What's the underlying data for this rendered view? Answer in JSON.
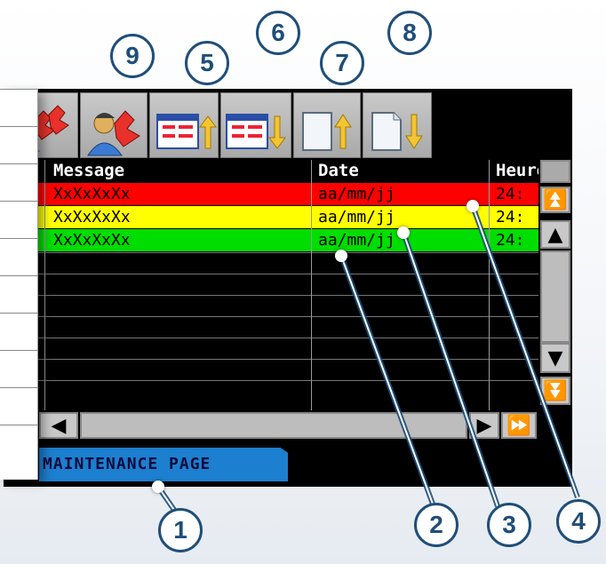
{
  "toolbar": {
    "buttons": [
      {
        "icon": "acknowledge-all-icon"
      },
      {
        "icon": "user-acknowledge-icon"
      },
      {
        "icon": "sort-list-ascending-icon"
      },
      {
        "icon": "sort-list-descending-icon"
      },
      {
        "icon": "page-up-icon"
      },
      {
        "icon": "page-down-icon"
      }
    ]
  },
  "grid": {
    "headers": {
      "message": "Message",
      "date": "Date",
      "hour": "Heure"
    },
    "rows": [
      {
        "message": "XxXxXxXx",
        "date": "aa/mm/jj",
        "hour": "24:",
        "bg": "#ff0000",
        "fg": "#000000"
      },
      {
        "message": "XxXxXxXx",
        "date": "aa/mm/jj",
        "hour": "24:",
        "bg": "#ffff00",
        "fg": "#000000"
      },
      {
        "message": "XxXxXxXx",
        "date": "aa/mm/jj",
        "hour": "24:",
        "bg": "#00dd00",
        "fg": "#000000"
      }
    ]
  },
  "maintenance_tab": {
    "label": "MAINTENANCE PAGE"
  },
  "callouts": [
    "1",
    "2",
    "3",
    "4",
    "5",
    "6",
    "7",
    "8",
    "9"
  ],
  "colors": {
    "callout": "#1f4e79",
    "tab": "#1c7fcf",
    "alarm_active": "#ff0000",
    "alarm_ack": "#ffff00",
    "alarm_cleared": "#00dd00"
  }
}
